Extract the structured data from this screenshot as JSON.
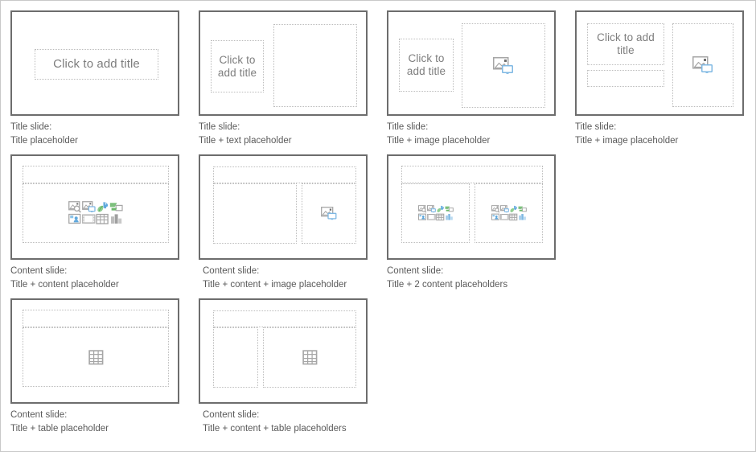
{
  "page": {
    "title": "Slide layout gallery",
    "background_color": "#ffffff",
    "frame_color": "#c9c9c9"
  },
  "colors": {
    "thumb_border": "#6d6d6d",
    "placeholder_border": "#bcbcbc",
    "placeholder_text": "#7d7d7d",
    "caption_text": "#5a5a5a",
    "icon_gray": "#a6a6a6",
    "icon_blue": "#7fb8e3",
    "icon_green": "#7fbd7f"
  },
  "placeholder_prompt": "Click to add title",
  "layouts": [
    {
      "id": "title-slide-title-placeholder",
      "caption_line1": "Title slide:",
      "caption_line2": "Title placeholder",
      "caption_text": "Title slide:\nTitle placeholder",
      "title_prompt": "Click to add title",
      "placeholders": [
        "title"
      ],
      "icons": []
    },
    {
      "id": "title-slide-title-text-placeholder",
      "caption_line1": "Title slide:",
      "caption_line2": "Title + text placeholder",
      "caption_text": "Title slide:\nTitle + text placeholder",
      "title_prompt": "Click to\nadd title",
      "placeholders": [
        "title",
        "text"
      ],
      "icons": []
    },
    {
      "id": "title-slide-title-image-placeholder",
      "caption_line1": "Title slide:",
      "caption_line2": "Title + image placeholder",
      "caption_text": "Title slide:\nTitle + image placeholder",
      "title_prompt": "Click to\nadd title",
      "placeholders": [
        "title",
        "image"
      ],
      "icons": [
        "image-icon"
      ]
    },
    {
      "id": "title-slide-title-image-placeholder-2",
      "caption_line1": "Title slide:",
      "caption_line2": "Title + image placeholder",
      "caption_text": "Title slide:\nTitle + image placeholder",
      "title_prompt": "Click to\nadd title",
      "placeholders": [
        "title",
        "subtitle",
        "image"
      ],
      "icons": [
        "image-icon"
      ]
    },
    {
      "id": "content-slide-title-content-placeholder",
      "caption_line1": "Content slide:",
      "caption_line2": "Title + content placeholder",
      "caption_text": "Content slide:\nTitle + content placeholder",
      "title_prompt": "",
      "placeholders": [
        "title",
        "content"
      ],
      "icons": [
        "picture-search-icon",
        "stock-images-icon",
        "3d-model-icon",
        "smartart-icon",
        "picture-person-icon",
        "video-icon",
        "table-icon",
        "chart-icon"
      ]
    },
    {
      "id": "content-slide-title-content-image-placeholder",
      "caption_line1": "Content slide:",
      "caption_line2": "Title + content + image placeholder",
      "caption_text": "Content slide:\nTitle + content + image placeholder",
      "title_prompt": "",
      "placeholders": [
        "title",
        "content",
        "image"
      ],
      "icons": [
        "image-icon"
      ]
    },
    {
      "id": "content-slide-title-2-content-placeholders",
      "caption_line1": "Content slide:",
      "caption_line2": "Title + 2 content placeholders",
      "caption_text": "Content slide:\nTitle + 2 content placeholders",
      "title_prompt": "",
      "placeholders": [
        "title",
        "content-left",
        "content-right"
      ],
      "icons": [
        "picture-search-icon",
        "stock-images-icon",
        "3d-model-icon",
        "smartart-icon",
        "picture-person-icon",
        "video-icon",
        "table-icon",
        "chart-icon"
      ]
    },
    {
      "id": "content-slide-title-table-placeholder",
      "caption_line1": "Content slide:",
      "caption_line2": "Title + table placeholder",
      "caption_text": "Content slide:\nTitle + table placeholder",
      "title_prompt": "",
      "placeholders": [
        "title",
        "table"
      ],
      "icons": [
        "table-icon"
      ]
    },
    {
      "id": "content-slide-title-content-table-placeholders",
      "caption_line1": "Content slide:",
      "caption_line2": "Title + content + table placeholders",
      "caption_text": "Content slide:\nTitle + content + table placeholders",
      "title_prompt": "",
      "placeholders": [
        "title",
        "content",
        "table"
      ],
      "icons": [
        "table-icon"
      ]
    }
  ]
}
